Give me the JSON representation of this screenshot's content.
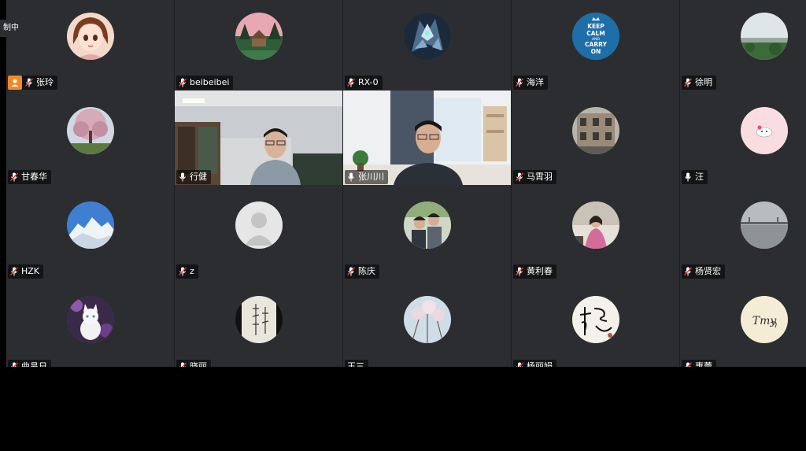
{
  "status_tab": {
    "text": "制中"
  },
  "participants": [
    {
      "name": "张玲",
      "host": true,
      "avatar": "anime-girl"
    },
    {
      "name": "beibeibei",
      "avatar": "cabin-forest"
    },
    {
      "name": "RX-0",
      "avatar": "robot"
    },
    {
      "name": "海洋",
      "avatar": "keep-calm",
      "avatar_text": [
        "KEEP",
        "CALM",
        "AND",
        "CARRY",
        "ON"
      ]
    },
    {
      "name": "徐明",
      "avatar": "landscape-sky"
    },
    {
      "name": "甘春华",
      "avatar": "blossom-tree"
    },
    {
      "name": "行健",
      "video": true,
      "mic_on": true
    },
    {
      "name": "张川川",
      "video": true,
      "mic_on": true
    },
    {
      "name": "马霄羽",
      "avatar": "building"
    },
    {
      "name": "汪",
      "mic_on": true,
      "avatar": "cartoon-pink"
    },
    {
      "name": "HZK",
      "avatar": "snow-mountain"
    },
    {
      "name": "z",
      "avatar": "default-person"
    },
    {
      "name": "陈庆",
      "avatar": "family-photo"
    },
    {
      "name": "黄利春",
      "avatar": "woman-photo"
    },
    {
      "name": "杨贤宏",
      "avatar": "river-bridge"
    },
    {
      "name": "曲昌日",
      "avatar": "white-cat"
    },
    {
      "name": "晓丽",
      "avatar": "calligraphy"
    },
    {
      "name": "王三",
      "avatar": "cherry-blossom"
    },
    {
      "name": "杨丽娟",
      "avatar": "signature-yang"
    },
    {
      "name": "惠蕾",
      "avatar": "signature-tmy",
      "avatar_text": [
        "Tmy"
      ]
    }
  ]
}
